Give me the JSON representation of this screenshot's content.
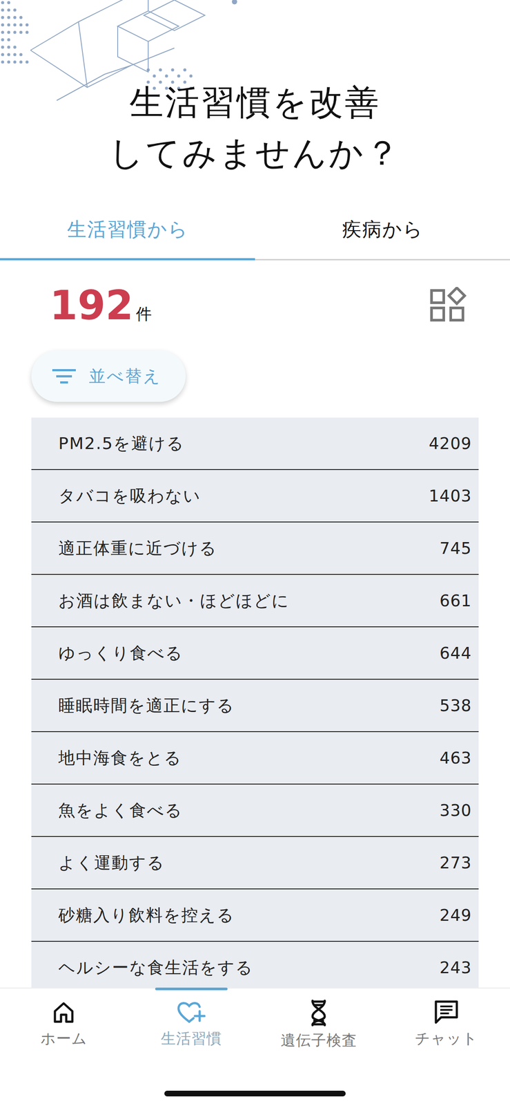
{
  "title": [
    "生活習慣を改善",
    "してみませんか？"
  ],
  "tabs": [
    {
      "label": "生活習慣から",
      "selected": true
    },
    {
      "label": "疾病から",
      "selected": false
    }
  ],
  "result": {
    "count": "192",
    "unit": "件"
  },
  "sort_button": {
    "label": "並べ替え"
  },
  "habits": [
    {
      "label": "PM2.5を避ける",
      "count": "4209"
    },
    {
      "label": "タバコを吸わない",
      "count": "1403"
    },
    {
      "label": "適正体重に近づける",
      "count": "745"
    },
    {
      "label": "お酒は飲まない・ほどほどに",
      "count": "661"
    },
    {
      "label": "ゆっくり食べる",
      "count": "644"
    },
    {
      "label": "睡眠時間を適正にする",
      "count": "538"
    },
    {
      "label": "地中海食をとる",
      "count": "463"
    },
    {
      "label": "魚をよく食べる",
      "count": "330"
    },
    {
      "label": "よく運動する",
      "count": "273"
    },
    {
      "label": "砂糖入り飲料を控える",
      "count": "249"
    },
    {
      "label": "ヘルシーな食生活をする",
      "count": "243"
    }
  ],
  "bottom_nav": [
    {
      "label": "ホーム",
      "selected": false
    },
    {
      "label": "生活習慣",
      "selected": true
    },
    {
      "label": "遺伝子検査",
      "selected": false
    },
    {
      "label": "チャット",
      "selected": false
    }
  ]
}
